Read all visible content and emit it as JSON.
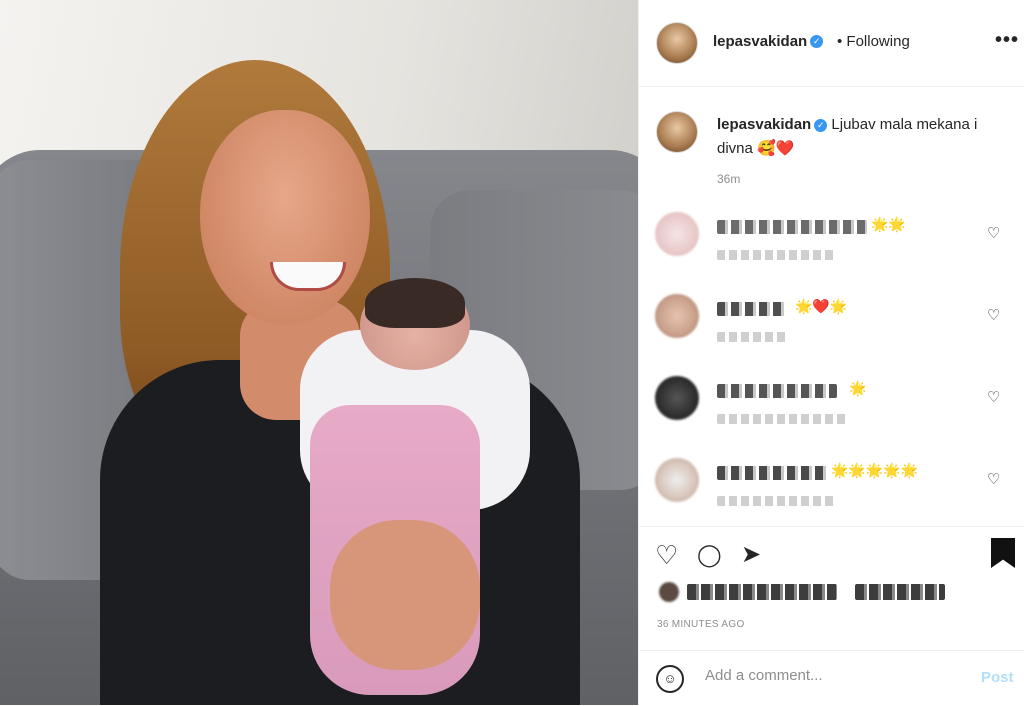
{
  "post": {
    "username": "lepasvakidan",
    "following_label": "• Following",
    "more_label": "•••",
    "caption_text": "Ljubav mala mekana i divna",
    "caption_emoji": "🥰❤️",
    "caption_time": "36m"
  },
  "comments": [
    {
      "avatar_color": "#e9c9c9",
      "text_color": "#6b6b6b",
      "emoji": "🌟🌟"
    },
    {
      "avatar_color": "#c9a08a",
      "text_color": "#4f4f4f",
      "emoji": "🌟❤️🌟"
    },
    {
      "avatar_color": "#2e2e2e",
      "text_color": "#555555",
      "emoji": "🌟"
    },
    {
      "avatar_color": "#d7c3b7",
      "text_color": "#4a4a4a",
      "emoji": "🌟🌟🌟🌟🌟"
    }
  ],
  "actions": {
    "like_icon": "heart-outline-icon",
    "comment_icon": "comment-icon",
    "share_icon": "share-icon",
    "save_icon": "bookmark-filled-icon"
  },
  "footer": {
    "time_ago": "36 MINUTES AGO",
    "comment_placeholder": "Add a comment...",
    "post_label": "Post"
  },
  "colors": {
    "accent": "#3897f0",
    "post_disabled": "#b2dffc",
    "muted_text": "#8e8e8e"
  }
}
